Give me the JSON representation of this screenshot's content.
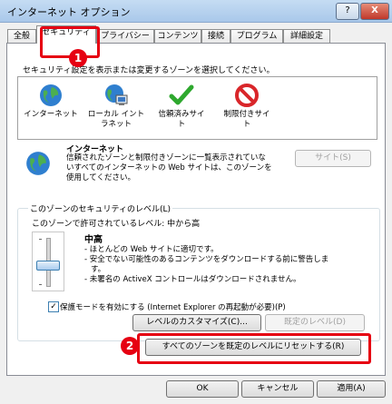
{
  "window": {
    "title": "インターネット オプション",
    "help_label": "?",
    "close_label": "X"
  },
  "tabs": [
    "全般",
    "セキュリティ",
    "プライバシー",
    "コンテンツ",
    "接続",
    "プログラム",
    "詳細設定"
  ],
  "badges": [
    "1",
    "2"
  ],
  "zones_prompt": "セキュリティ設定を表示または変更するゾーンを選択してください。",
  "zones": [
    {
      "label": "インターネット",
      "icon": "globe-icon"
    },
    {
      "label": "ローカル イント\nラネット",
      "icon": "intranet-icon"
    },
    {
      "label": "信頼済みサイ\nト",
      "icon": "checkmark-icon"
    },
    {
      "label": "制限付きサイ\nト",
      "icon": "restricted-icon"
    }
  ],
  "zone_info": {
    "title": "インターネット",
    "desc1": "信頼されたゾーンと制限付きゾーンに一覧表示されていな",
    "desc2": "いすべてのインターネットの Web サイトは、このゾーンを",
    "desc3": "使用してください。"
  },
  "sites_button": "サイト(S)",
  "security_level": {
    "group_title": "このゾーンのセキュリティのレベル(L)",
    "allowed": "このゾーンで許可されているレベル: 中から高",
    "level_name": "中高",
    "line1": "- ほとんどの Web サイトに適切です。",
    "line2": "- 安全でない可能性のあるコンテンツをダウンロードする前に警告しま",
    "line3": "す。",
    "line4": "- 未署名の ActiveX コントロールはダウンロードされません。"
  },
  "protected_mode": {
    "checked": true,
    "label": "保護モードを有効にする (Internet Explorer の再起動が必要)(P)"
  },
  "buttons": {
    "custom_level": "レベルのカスタマイズ(C)...",
    "default_level": "既定のレベル(D)",
    "reset_all": "すべてのゾーンを既定のレベルにリセットする(R)",
    "ok": "OK",
    "cancel": "キャンセル",
    "apply": "適用(A)"
  }
}
